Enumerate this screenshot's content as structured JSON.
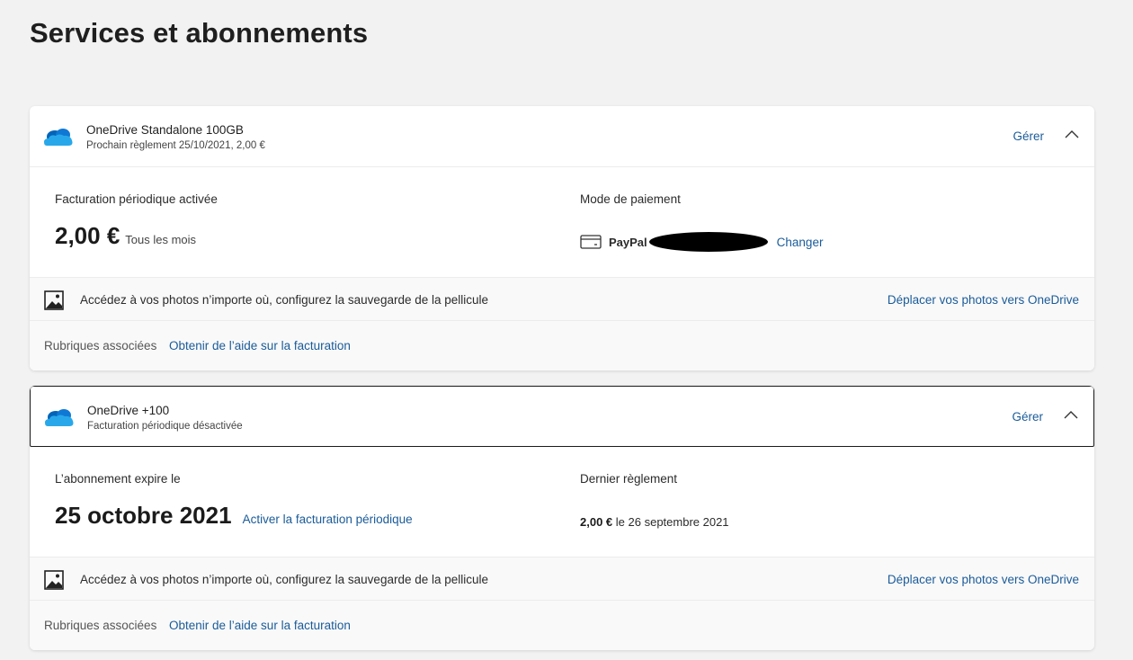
{
  "page": {
    "title": "Services et abonnements"
  },
  "subscriptions": [
    {
      "name": "OneDrive Standalone 100GB",
      "detail": "Prochain règlement 25/10/2021, 2,00 €",
      "manage_label": "Gérer",
      "left_label": "Facturation périodique activée",
      "price": "2,00 €",
      "price_period": "Tous les mois",
      "right_label": "Mode de paiement",
      "payment_method": "PayPal",
      "change_label": "Changer",
      "promo_text": "Accédez à vos photos n’importe où, configurez la sauvegarde de la pellicule",
      "promo_link": "Déplacer vos photos vers OneDrive",
      "related_label": "Rubriques associées",
      "help_link": "Obtenir de l’aide sur la facturation"
    },
    {
      "name": "OneDrive +100",
      "detail": "Facturation périodique désactivée",
      "manage_label": "Gérer",
      "left_label": "L’abonnement expire le",
      "expiry_date": "25 octobre 2021",
      "activate_label": "Activer la facturation périodique",
      "right_label": "Dernier règlement",
      "last_amount": "2,00 €",
      "last_date": "le 26 septembre 2021",
      "promo_text": "Accédez à vos photos n’importe où, configurez la sauvegarde de la pellicule",
      "promo_link": "Déplacer vos photos vers OneDrive",
      "related_label": "Rubriques associées",
      "help_link": "Obtenir de l’aide sur la facturation"
    }
  ],
  "icons": {
    "product": "onedrive-cloud-icon",
    "expand": "chevron-up-icon",
    "payment": "credit-card-icon",
    "promo": "photo-icon"
  },
  "colors": {
    "link": "#1a5b99",
    "cloud_dark": "#0364b8",
    "cloud_mid": "#0f78d4",
    "cloud_light": "#28a8ea"
  }
}
